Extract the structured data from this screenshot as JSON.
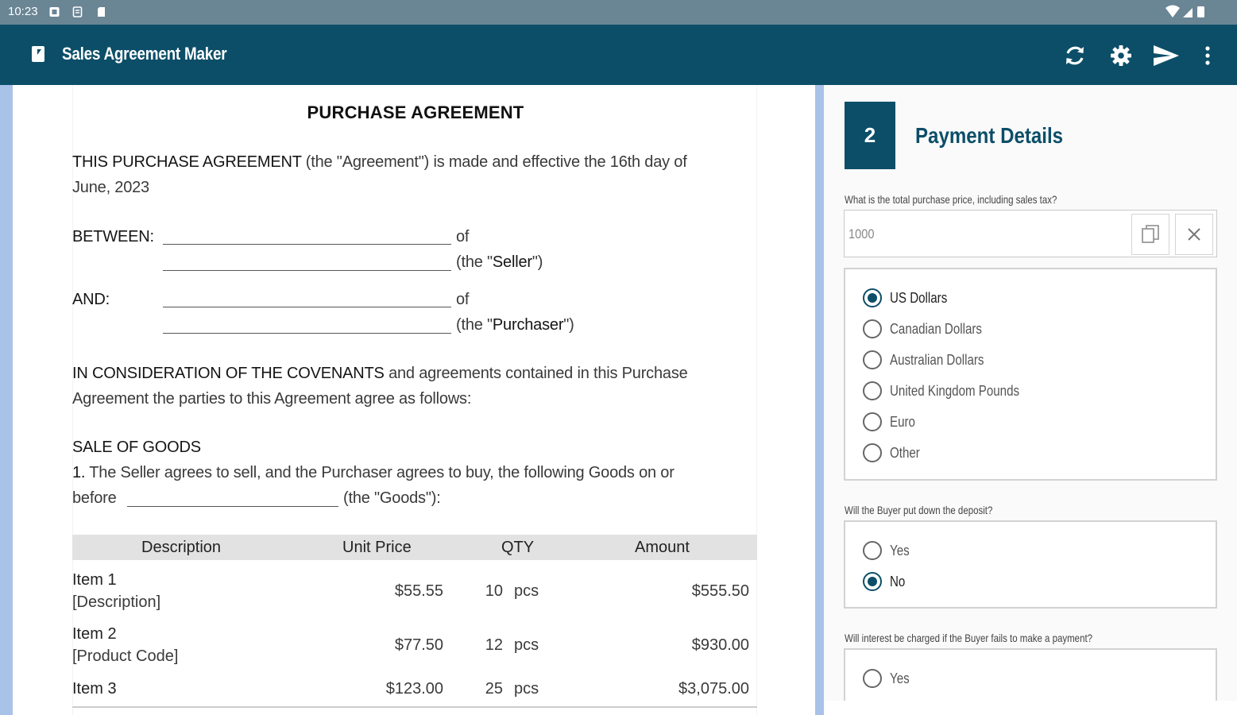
{
  "status_bar": {
    "time": "10:23"
  },
  "app_bar": {
    "title": "Sales Agreement Maker",
    "actions": [
      "refresh-icon",
      "gear-icon",
      "send-icon",
      "more-vert-icon"
    ]
  },
  "document": {
    "heading": "PURCHASE AGREEMENT",
    "intro_strong": "THIS PURCHASE AGREEMENT",
    "intro_rest": "(the \"Agreement\") is made and effective the 16th day of",
    "intro_line2": "June, 2023",
    "between_label": "BETWEEN:",
    "of_1": "of",
    "seller_open": "(the \"",
    "seller_word": "Seller",
    "seller_close": "\")",
    "and_label": "AND:",
    "of_2": "of",
    "purchaser_open": "(the \"",
    "purchaser_word": "Purchaser",
    "purchaser_close": "\")",
    "consideration_strong": "IN CONSIDERATION OF THE COVENANTS",
    "consideration_rest": "and agreements contained in this Purchase",
    "consideration_line2": "Agreement the parties to this Agreement agree as follows:",
    "sale_heading": "SALE OF GOODS",
    "clause_number": "1.",
    "clause_text": "The Seller agrees to sell, and the Purchaser agrees to buy, the following Goods on or",
    "clause_line2_start": "before",
    "clause_line2_end": "(the \"Goods\"):",
    "table": {
      "headers": [
        "Description",
        "Unit Price",
        "QTY",
        "Amount"
      ],
      "rows": [
        {
          "name": "Item 1",
          "sub": "[Description]",
          "unit_price": "$55.55",
          "qty": "10",
          "unit": "pcs",
          "amount": "$555.50"
        },
        {
          "name": "Item 2",
          "sub": "[Product Code]",
          "unit_price": "$77.50",
          "qty": "12",
          "unit": "pcs",
          "amount": "$930.00"
        },
        {
          "name": "Item 3",
          "sub": "",
          "unit_price": "$123.00",
          "qty": "25",
          "unit": "pcs",
          "amount": "$3,075.00"
        }
      ]
    }
  },
  "panel": {
    "step_number": "2",
    "section_title": "Payment Details",
    "q_price": "What is the total purchase price, including sales tax?",
    "price_value": "1000",
    "currency_options": [
      {
        "label": "US Dollars",
        "selected": true
      },
      {
        "label": "Canadian Dollars",
        "selected": false
      },
      {
        "label": "Australian Dollars",
        "selected": false
      },
      {
        "label": "United Kingdom Pounds",
        "selected": false
      },
      {
        "label": "Euro",
        "selected": false
      },
      {
        "label": "Other",
        "selected": false
      }
    ],
    "q_deposit": "Will the Buyer put down the deposit?",
    "deposit_options": [
      {
        "label": "Yes",
        "selected": false
      },
      {
        "label": "No",
        "selected": true
      }
    ],
    "q_interest": "Will interest be charged if the Buyer fails to make a payment?",
    "interest_options": [
      {
        "label": "Yes",
        "selected": false
      }
    ]
  }
}
